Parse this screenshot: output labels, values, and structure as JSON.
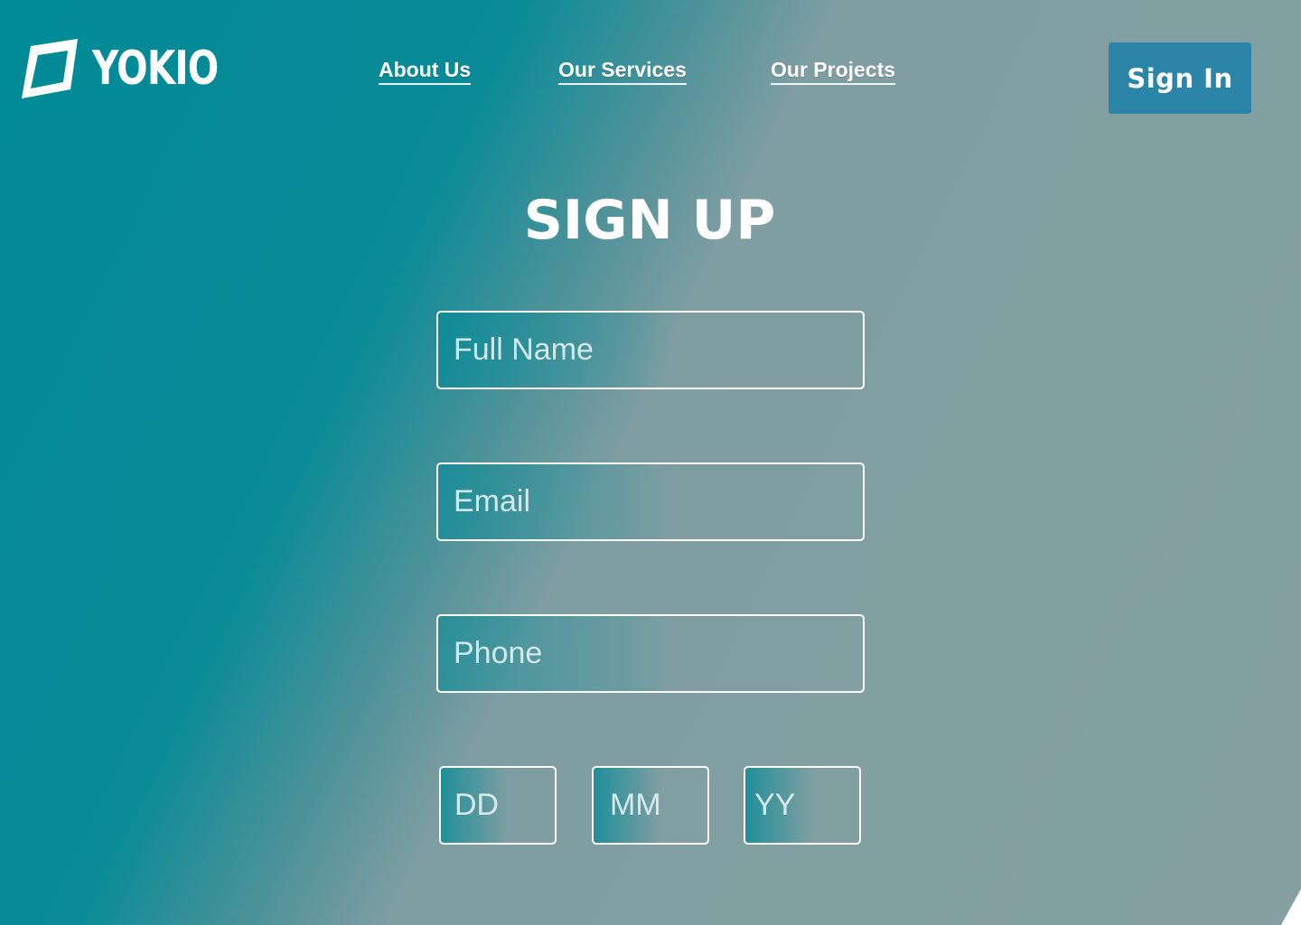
{
  "brand": {
    "logo_icon": "parallelogram-logo-icon",
    "name": "YOKIO"
  },
  "nav": {
    "items": [
      {
        "label": "About Us"
      },
      {
        "label": "Our Services"
      },
      {
        "label": "Our Projects"
      }
    ]
  },
  "header": {
    "signin_label": "Sign In"
  },
  "form": {
    "title": "SIGN UP",
    "full_name_placeholder": "Full Name",
    "email_placeholder": "Email",
    "phone_placeholder": "Phone",
    "dob": {
      "day_placeholder": "DD",
      "month_placeholder": "MM",
      "year_placeholder": "YY"
    }
  },
  "colors": {
    "gradient_start": "#008a97",
    "gradient_end": "#84a0a3",
    "signin_button": "#2b85a8",
    "text": "#ffffff"
  }
}
